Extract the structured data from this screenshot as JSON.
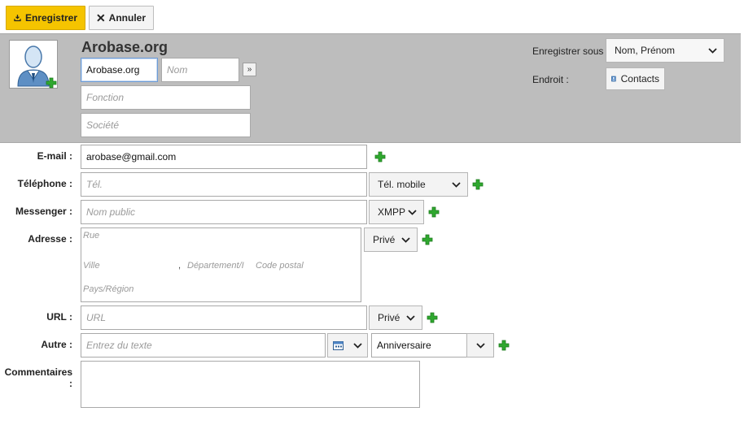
{
  "toolbar": {
    "save_label": "Enregistrer",
    "cancel_label": "Annuler"
  },
  "header": {
    "title": "Arobase.org",
    "first_name_value": "Arobase.org",
    "last_name_placeholder": "Nom",
    "expand_label": "»",
    "function_placeholder": "Fonction",
    "company_placeholder": "Société",
    "save_as_label": "Enregistrer sous :",
    "save_as_value": "Nom, Prénom",
    "location_label": "Endroit :",
    "location_button": "Contacts"
  },
  "form": {
    "email": {
      "label": "E-mail :",
      "value": "arobase@gmail.com"
    },
    "phone": {
      "label": "Téléphone :",
      "placeholder": "Tél.",
      "type": "Tél. mobile"
    },
    "messenger": {
      "label": "Messenger :",
      "placeholder": "Nom public",
      "type": "XMPP"
    },
    "address": {
      "label": "Adresse :",
      "street_placeholder": "Rue",
      "city_placeholder": "Ville",
      "separator": ",",
      "department_placeholder": "Département/I",
      "postal_placeholder": "Code postal",
      "country_placeholder": "Pays/Région",
      "type": "Privé"
    },
    "url": {
      "label": "URL :",
      "placeholder": "URL",
      "type": "Privé"
    },
    "other": {
      "label": "Autre :",
      "placeholder": "Entrez du texte",
      "type": "Anniversaire"
    },
    "comments": {
      "label": "Commentaires :"
    }
  },
  "colors": {
    "accent": "#f5c400",
    "band": "#bdbdbd",
    "add": "#2fa82f"
  },
  "icons": {
    "save": "download-tray-icon",
    "cancel": "close-icon",
    "avatar": "user-avatar-icon",
    "add": "plus-icon",
    "dropdown": "chevron-down-icon",
    "calendar": "calendar-icon",
    "contacts": "address-book-icon"
  }
}
